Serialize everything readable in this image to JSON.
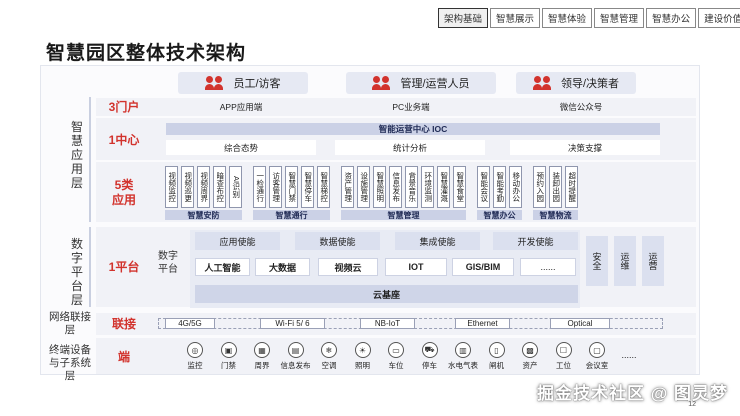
{
  "nav": [
    "架构基础",
    "智慧展示",
    "智慧体验",
    "智慧管理",
    "智慧办公",
    "建设价值"
  ],
  "title": "智慧园区整体技术架构",
  "users": [
    "员工/访客",
    "管理/运营人员",
    "领导/决策者"
  ],
  "groups": {
    "smart_app": [
      "智",
      "慧",
      "应",
      "用",
      "层"
    ],
    "digital_platform": [
      "数",
      "字",
      "平",
      "台",
      "层"
    ],
    "network": "网络联接层",
    "terminal": "终端设备与子系统层"
  },
  "portal": {
    "label": "3门户",
    "items": [
      "APP应用端",
      "PC业务端",
      "微信公众号"
    ]
  },
  "center": {
    "label": "1中心",
    "ioc": "智能运营中心 IOC",
    "items": [
      "综合态势",
      "统计分析",
      "决策支撑"
    ]
  },
  "apps": {
    "label": [
      "5类",
      "应用"
    ],
    "groups": [
      {
        "name": "智慧安防",
        "items": [
          "视频监控",
          "视频巡更",
          "视频周界",
          "暗查布控",
          "AI识别"
        ]
      },
      {
        "name": "智慧通行",
        "items": [
          "一检通行",
          "访客管理",
          "智慧门禁",
          "智慧停车",
          "智慧梯控"
        ]
      },
      {
        "name": "智慧管理",
        "items": [
          "资产管理",
          "设施管理",
          "智慧照明",
          "信息发布",
          "背景音乐",
          "环境监测",
          "智慧灌溉",
          "智慧食堂"
        ]
      },
      {
        "name": "智慧办公",
        "items": [
          "智能会议",
          "智能考勤",
          "移动办公"
        ]
      },
      {
        "name": "智慧物流",
        "items": [
          "预约入园",
          "装卸出园",
          "超时提醒"
        ]
      }
    ]
  },
  "platform": {
    "label": "1平台",
    "name": [
      "数字",
      "平台"
    ],
    "enablers": [
      "应用使能",
      "数据使能",
      "集成使能",
      "开发使能"
    ],
    "services": [
      "人工智能",
      "大数据",
      "视频云",
      "IOT",
      "GIS/BIM",
      "......"
    ],
    "base": "云基座",
    "side": [
      "安全",
      "运维",
      "运营"
    ]
  },
  "network": {
    "label": "联接",
    "items": [
      "4G/5G",
      "Wi-Fi 5/ 6",
      "NB-IoT",
      "Ethernet",
      "Optical"
    ]
  },
  "terminal": {
    "label": "端",
    "items": [
      "监控",
      "门禁",
      "周界",
      "信息发布",
      "空调",
      "照明",
      "车位",
      "停车",
      "水电气表",
      "闸机",
      "资产",
      "工位",
      "会议室"
    ],
    "more": "......"
  },
  "watermark": "掘金技术社区 @ 图灵梦",
  "page": "12"
}
